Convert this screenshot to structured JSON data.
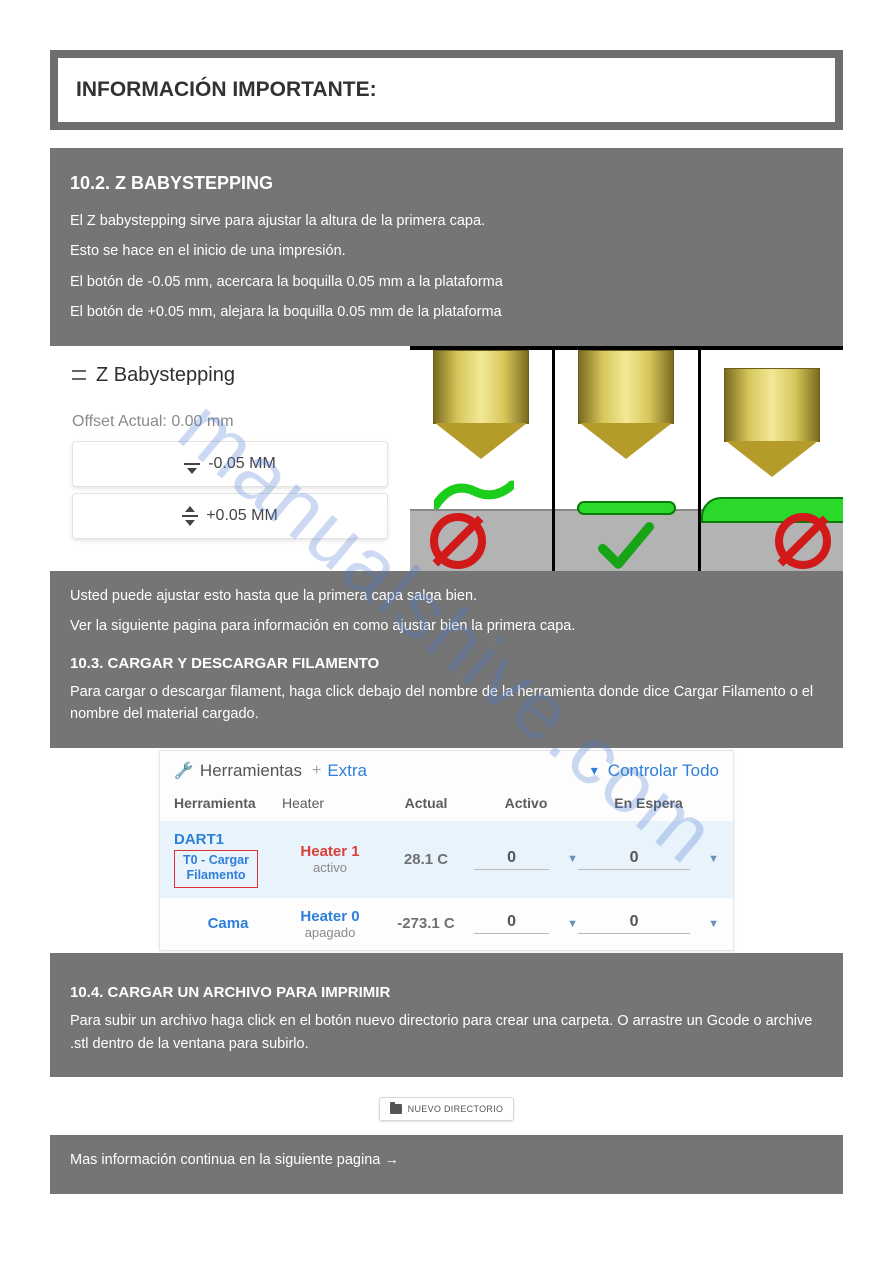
{
  "watermark": "manualshive.com",
  "frame": {
    "title": "INFORMACIÓN IMPORTANTE:"
  },
  "sec_babystep": {
    "heading": "10.2. Z BABYSTEPPING",
    "p1": "El Z babystepping sirve para ajustar la altura de la primera capa.",
    "p2": "Esto se hace en el inicio de una impresión.",
    "p3": "El botón de -0.05 mm, acercara la boquilla 0.05 mm a la plataforma",
    "p4": "El botón de +0.05 mm, alejara la boquilla 0.05 mm de la plataforma"
  },
  "zbaby": {
    "title": "Z Babystepping",
    "offset_label": "Offset Actual: 0.00 mm",
    "btn_minus": "-0.05 MM",
    "btn_plus": "+0.05 MM"
  },
  "sec_gap": {
    "p1": "Usted puede ajustar esto hasta que la primera capa salga bien.",
    "p2": "Ver la siguiente pagina para información en como ajustar bien la primera capa.",
    "heading": "10.3. CARGAR Y DESCARGAR FILAMENTO",
    "p3": "Para cargar o descargar filament, haga click debajo del nombre de la herramienta donde dice Cargar Filamento o el nombre del material cargado."
  },
  "tools": {
    "title": "Herramientas",
    "extra": "Extra",
    "control_all": "Controlar Todo",
    "headers": {
      "tool": "Herramienta",
      "heater": "Heater",
      "actual": "Actual",
      "active": "Activo",
      "standby": "En Espera"
    },
    "rows": [
      {
        "tool_name": "DART1",
        "load_line1": "T0 - Cargar",
        "load_line2": "Filamento",
        "heater_name": "Heater 1",
        "heater_state": "activo",
        "actual": "28.1 C",
        "active_val": "0",
        "standby_val": "0"
      },
      {
        "tool_name": "Cama",
        "heater_name": "Heater 0",
        "heater_state": "apagado",
        "actual": "-273.1 C",
        "active_val": "0",
        "standby_val": "0"
      }
    ]
  },
  "sec_upload": {
    "heading": "10.4. CARGAR UN ARCHIVO PARA IMPRIMIR",
    "p1": "Para subir un archivo haga click en el botón nuevo directorio para crear una carpeta. O arrastre un Gcode o archive .stl dentro de la ventana para subirlo."
  },
  "newdir": {
    "label": "NUEVO DIRECTORIO"
  },
  "footer": "Mas información continua en la siguiente pagina  →"
}
